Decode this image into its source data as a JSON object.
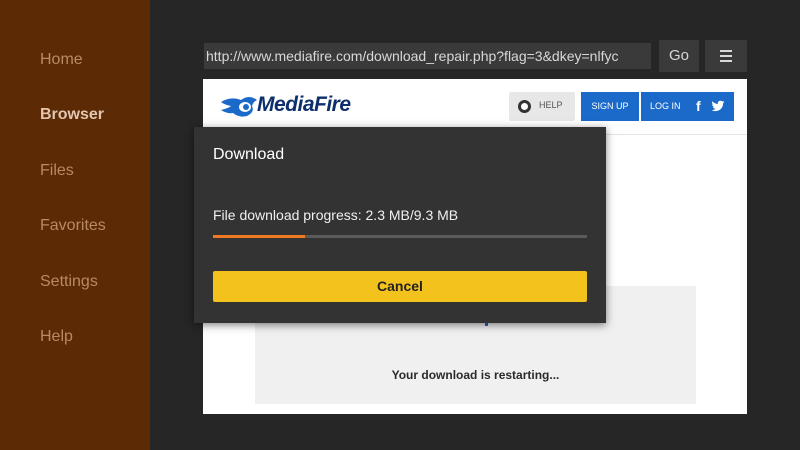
{
  "sidebar": {
    "items": [
      {
        "label": "Home",
        "active": false
      },
      {
        "label": "Browser",
        "active": true
      },
      {
        "label": "Files",
        "active": false
      },
      {
        "label": "Favorites",
        "active": false
      },
      {
        "label": "Settings",
        "active": false
      },
      {
        "label": "Help",
        "active": false
      }
    ]
  },
  "toolbar": {
    "url": "http://www.mediafire.com/download_repair.php?flag=3&dkey=nlfyc",
    "go_label": "Go",
    "menu_icon": "hamburger-icon"
  },
  "webpage": {
    "logo_text": "MediaFire",
    "help_label": "HELP",
    "signup_label": "SIGN UP",
    "login_label": "LOG IN",
    "facebook_glyph": "f",
    "restart_message": "Your download is restarting..."
  },
  "dialog": {
    "title": "Download",
    "progress_text": "File download progress: 2.3 MB/9.3 MB",
    "progress_downloaded_mb": 2.3,
    "progress_total_mb": 9.3,
    "cancel_label": "Cancel"
  },
  "colors": {
    "sidebar_bg": "#5c2a04",
    "progress_accent": "#f07a24",
    "cancel_button": "#f4c21d",
    "mediafire_blue": "#1b6ac9"
  }
}
